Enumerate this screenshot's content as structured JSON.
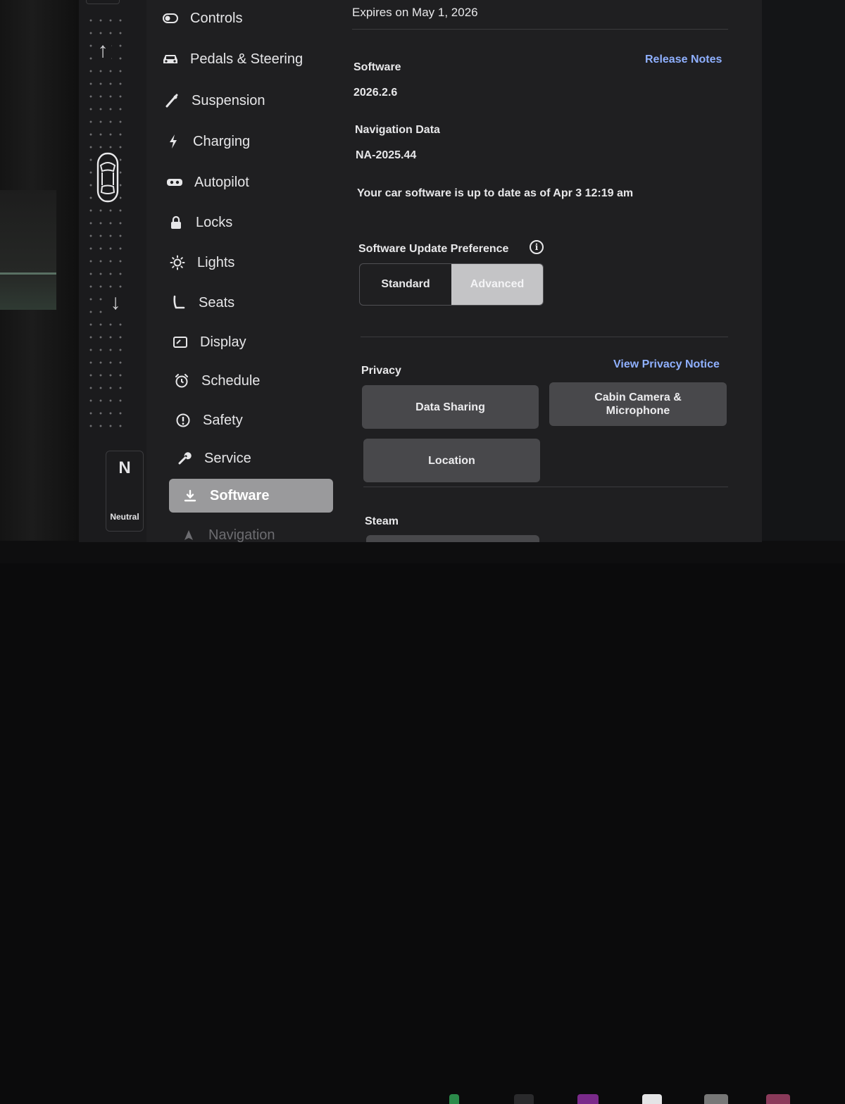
{
  "gear": {
    "current": "N",
    "label": "Neutral",
    "up_arrow": "↑",
    "down_arrow": "↓",
    "car_icon": "car-top-view-icon"
  },
  "sidebar": {
    "items": [
      {
        "label": "Controls",
        "icon": "toggle-icon"
      },
      {
        "label": "Pedals & Steering",
        "icon": "car-icon"
      },
      {
        "label": "Suspension",
        "icon": "suspension-icon"
      },
      {
        "label": "Charging",
        "icon": "lightning-icon"
      },
      {
        "label": "Autopilot",
        "icon": "steering-wheel-icon"
      },
      {
        "label": "Locks",
        "icon": "lock-icon"
      },
      {
        "label": "Lights",
        "icon": "sun-icon"
      },
      {
        "label": "Seats",
        "icon": "seat-icon"
      },
      {
        "label": "Display",
        "icon": "display-icon"
      },
      {
        "label": "Schedule",
        "icon": "alarm-clock-icon"
      },
      {
        "label": "Safety",
        "icon": "alert-circle-icon"
      },
      {
        "label": "Service",
        "icon": "wrench-icon"
      },
      {
        "label": "Software",
        "icon": "download-icon",
        "active": true
      },
      {
        "label": "Navigation",
        "icon": "navigation-arrow-icon"
      }
    ]
  },
  "main": {
    "expires_text": "Expires on May 1, 2026",
    "release_notes_link": "Release Notes",
    "software_label": "Software",
    "software_version": "2026.2.6",
    "nav_data_label": "Navigation Data",
    "nav_data_version": "NA-2025.44",
    "status_text": "Your car software is up to date as of Apr 3 12:19 am",
    "update_pref_label": "Software Update Preference",
    "update_pref_options": [
      "Standard",
      "Advanced"
    ],
    "update_pref_selected": "Advanced",
    "privacy_label": "Privacy",
    "privacy_link": "View Privacy Notice",
    "privacy_buttons": {
      "data_sharing": "Data Sharing",
      "cabin_camera_line1": "Cabin Camera &",
      "cabin_camera_line2": "Microphone",
      "location": "Location"
    },
    "steam_label": "Steam"
  },
  "colors": {
    "background": "#1f1f21",
    "link": "#8fb0ff",
    "active_nav": "#9a9a9c",
    "selected_segment": "#c4c4c6",
    "button": "#48484b"
  }
}
